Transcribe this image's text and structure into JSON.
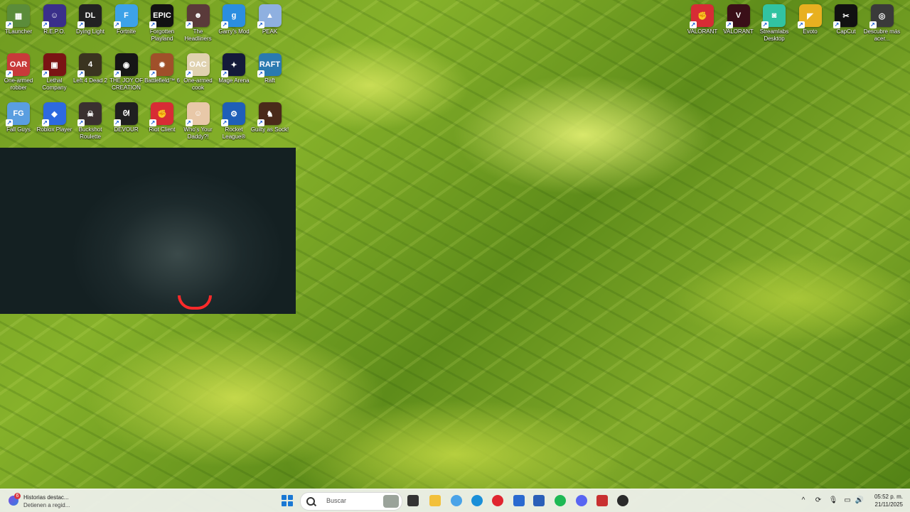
{
  "desktop": {
    "left_icons": [
      {
        "label": "TLauncher",
        "icon": "tlauncher-icon",
        "color": "#5b8c3a",
        "glyph": "▦"
      },
      {
        "label": "R.E.P.O.",
        "icon": "repo-icon",
        "color": "#3a2f8a",
        "glyph": "☺"
      },
      {
        "label": "Dying Light",
        "icon": "dying-light-icon",
        "color": "#222222",
        "glyph": "DL"
      },
      {
        "label": "Fortnite",
        "icon": "fortnite-icon",
        "color": "#3da2e8",
        "glyph": "F"
      },
      {
        "label": "Forgotten Playland",
        "icon": "epic-games-icon",
        "color": "#121212",
        "glyph": "EPIC"
      },
      {
        "label": "The Headliners",
        "icon": "headliners-icon",
        "color": "#5a3a3a",
        "glyph": "☻"
      },
      {
        "label": "Garry's Mod",
        "icon": "garrys-mod-icon",
        "color": "#2b8ee0",
        "glyph": "g"
      },
      {
        "label": "PEAK",
        "icon": "peak-icon",
        "color": "#8fb0e0",
        "glyph": "▲"
      },
      {
        "label": "One-armed robber",
        "icon": "one-armed-robber-icon",
        "color": "#c83a3a",
        "glyph": "OAR"
      },
      {
        "label": "Lethal Company",
        "icon": "lethal-company-icon",
        "color": "#7a1414",
        "glyph": "▣"
      },
      {
        "label": "Left 4 Dead 2",
        "icon": "left4dead2-icon",
        "color": "#3a3420",
        "glyph": "4"
      },
      {
        "label": "THE JOY OF CREATION",
        "icon": "joy-of-creation-icon",
        "color": "#161616",
        "glyph": "◉"
      },
      {
        "label": "Battlefield™ 6",
        "icon": "battlefield-icon",
        "color": "#a0502a",
        "glyph": "✹"
      },
      {
        "label": "One-armed cook",
        "icon": "one-armed-cook-icon",
        "color": "#e0d2b0",
        "glyph": "OAC"
      },
      {
        "label": "Mage Arena",
        "icon": "mage-arena-icon",
        "color": "#141a3a",
        "glyph": "✦"
      },
      {
        "label": "Raft",
        "icon": "raft-icon",
        "color": "#2a7ab0",
        "glyph": "RAFT"
      },
      {
        "label": "Fall Guys",
        "icon": "fall-guys-icon",
        "color": "#5a9ee0",
        "glyph": "FG"
      },
      {
        "label": "Roblox Player",
        "icon": "roblox-icon",
        "color": "#2d6ae0",
        "glyph": "◆"
      },
      {
        "label": "Buckshot Roulette",
        "icon": "buckshot-roulette-icon",
        "color": "#3a3030",
        "glyph": "☠"
      },
      {
        "label": "DEVOUR",
        "icon": "devour-icon",
        "color": "#202020",
        "glyph": "ᘛ"
      },
      {
        "label": "Riot Client",
        "icon": "riot-client-icon",
        "color": "#d72c35",
        "glyph": "✊"
      },
      {
        "label": "Who's Your Daddy?!",
        "icon": "whos-your-daddy-icon",
        "color": "#e8c8a8",
        "glyph": "☺"
      },
      {
        "label": "Rocket League®",
        "icon": "rocket-league-icon",
        "color": "#1f5fb8",
        "glyph": "⚙"
      },
      {
        "label": "Guilty as Sock!",
        "icon": "guilty-as-sock-icon",
        "color": "#4a2a1a",
        "glyph": "♞"
      }
    ],
    "right_icons": [
      {
        "label": "VALORANT",
        "icon": "riot-valorant-icon",
        "color": "#d72c35",
        "glyph": "✊"
      },
      {
        "label": "VALORANT",
        "icon": "valorant-icon",
        "color": "#3a0f18",
        "glyph": "V"
      },
      {
        "label": "Streamlabs Desktop",
        "icon": "streamlabs-icon",
        "color": "#31c3a2",
        "glyph": "◙"
      },
      {
        "label": "Evoto",
        "icon": "evoto-icon",
        "color": "#e8b020",
        "glyph": "◤"
      },
      {
        "label": "CapCut",
        "icon": "capcut-icon",
        "color": "#111111",
        "glyph": "✂"
      },
      {
        "label": "Descubre más acer...",
        "icon": "acer-discover-icon",
        "color": "#3a3a3a",
        "glyph": "◎"
      }
    ]
  },
  "webcam": {
    "label": "webcam overlay"
  },
  "taskbar": {
    "widget": {
      "badge": "6",
      "title": "Historias destac...",
      "subtitle": "Detienen a regid..."
    },
    "search": {
      "placeholder": "Buscar"
    },
    "apps": [
      {
        "name": "task-view-icon",
        "color": "#333333"
      },
      {
        "name": "file-explorer-icon",
        "color": "#f2c03a"
      },
      {
        "name": "copilot-icon",
        "color": "#4aa3e8"
      },
      {
        "name": "edge-icon",
        "color": "#1a8fd8"
      },
      {
        "name": "opera-icon",
        "color": "#e0252f"
      },
      {
        "name": "store-icon",
        "color": "#2a6ad0"
      },
      {
        "name": "word-icon",
        "color": "#2a5fb8"
      },
      {
        "name": "spotify-icon",
        "color": "#1db954"
      },
      {
        "name": "discord-icon",
        "color": "#5865f2"
      },
      {
        "name": "video-editor-icon",
        "color": "#c83030"
      },
      {
        "name": "obs-icon",
        "color": "#2a2a2a"
      }
    ],
    "clock": {
      "time": "05:52 p. m.",
      "date": "21/11/2025"
    }
  }
}
